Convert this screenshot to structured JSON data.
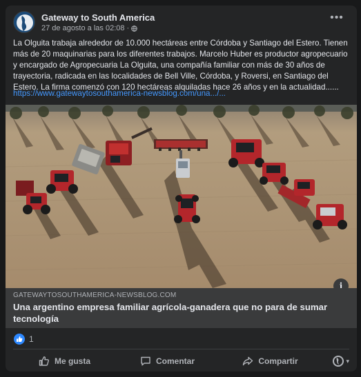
{
  "post": {
    "page_name": "Gateway to South America",
    "timestamp": "27 de agosto a las 02:08",
    "separator": "·",
    "text": "La Olguita trabaja alrededor de 10.000 hectáreas entre Córdoba y Santiago del Estero. Tienen más de 20 maquinarias para los diferentes trabajos. Marcelo Huber es productor agropecuario y encargado de Agropecuaria La Olguita, una compañía familiar con más de 30 años de trayectoria, radicada en las localidades de Bell Ville, Córdoba, y Roversi, en Santiago del Estero.    La firma comenzó con 120 hectáreas alquiladas hace 26 años y en la actualidad......",
    "link": "https://www.gatewaytosouthamerica-newsblog.com/una.../...",
    "more_label": "•••"
  },
  "link_preview": {
    "domain": "GATEWAYTOSOUTHAMERICA-NEWSBLOG.COM",
    "title": "Una argentino empresa familiar agrícola-ganadera que no para de sumar tecnología",
    "info_label": "i"
  },
  "reactions": {
    "count": "1"
  },
  "actions": {
    "like": "Me gusta",
    "comment": "Comentar",
    "share": "Compartir",
    "audience_chevron": "▾"
  },
  "colors": {
    "card_bg": "#242526",
    "link": "#4599ff",
    "like_blue": "#2d88ff",
    "tractor_red": "#b3262b"
  },
  "icons": [
    "globe-icon",
    "more-icon",
    "info-icon",
    "like-icon",
    "comment-icon",
    "share-icon"
  ]
}
